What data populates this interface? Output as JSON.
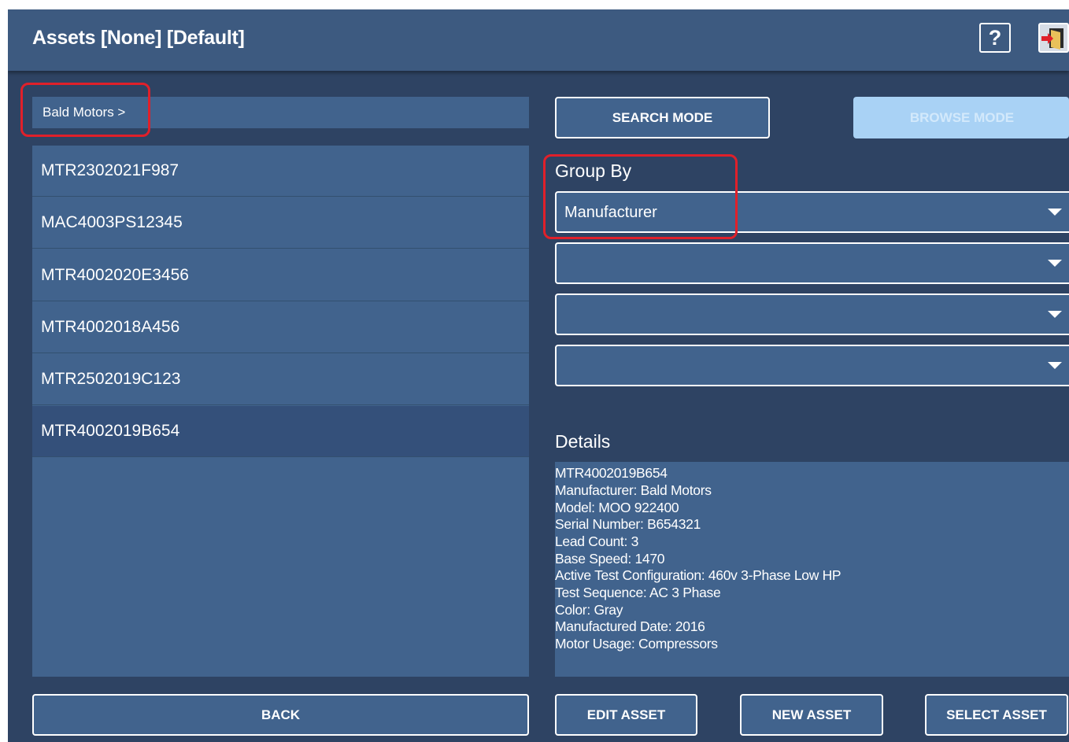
{
  "header": {
    "title": "Assets  [None] [Default]",
    "help_label": "?"
  },
  "breadcrumb": {
    "path": "Bald Motors >"
  },
  "asset_list": {
    "items": [
      "MTR2302021F987",
      "MAC4003PS12345",
      "MTR4002020E3456",
      "MTR4002018A456",
      "MTR2502019C123",
      "MTR4002019B654"
    ],
    "selected_index": 5
  },
  "mode_buttons": {
    "search": "SEARCH MODE",
    "browse": "BROWSE MODE"
  },
  "group_by": {
    "label": "Group By",
    "selects": [
      "Manufacturer",
      "",
      "",
      ""
    ]
  },
  "details": {
    "label": "Details",
    "lines": [
      "MTR4002019B654",
      "Manufacturer: Bald Motors",
      "Model: MOO 922400",
      "Serial Number: B654321",
      "Lead Count: 3",
      "Base Speed: 1470",
      "Active Test Configuration: 460v 3-Phase Low HP",
      "Test Sequence: AC 3 Phase",
      "Color: Gray",
      "Manufactured Date: 2016",
      "Motor Usage: Compressors"
    ]
  },
  "bottom_buttons": {
    "back": "BACK",
    "edit": "EDIT ASSET",
    "new": "NEW ASSET",
    "select": "SELECT ASSET"
  },
  "colors": {
    "background": "#2e4363",
    "panel": "#41638d",
    "header": "#3d5a80",
    "selected_row": "#34507a",
    "disabled_button": "#a9d2f5",
    "callout": "#e0202a"
  },
  "icons": {
    "help": "help-icon",
    "exit": "exit-door-icon",
    "dropdown": "chevron-down-icon"
  }
}
